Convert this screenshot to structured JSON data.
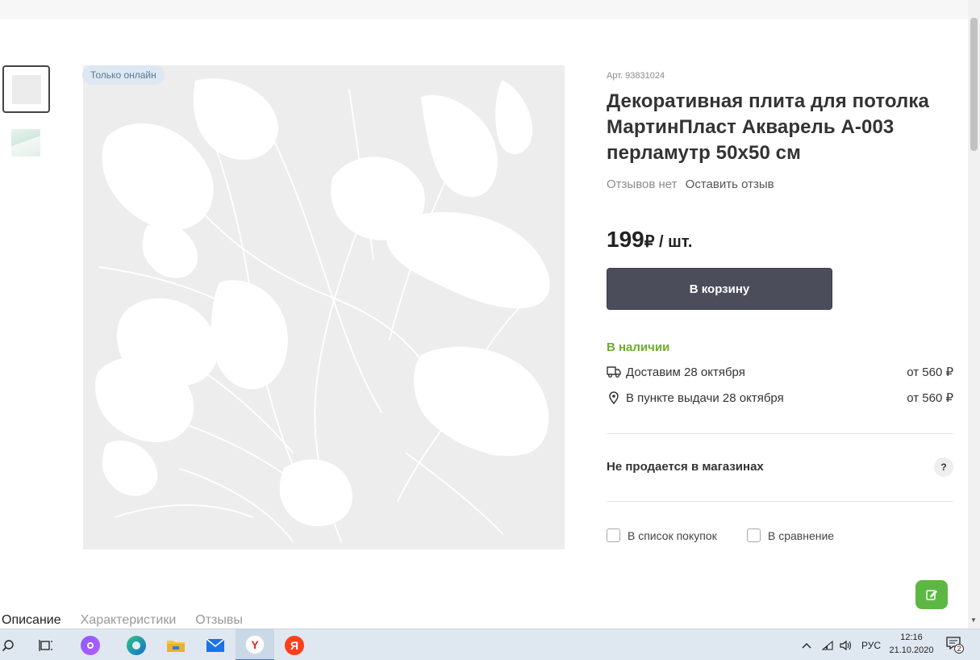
{
  "product": {
    "badge": "Только онлайн",
    "article": "Арт. 93831024",
    "title": "Декоративная плита для потолка МартинПласт Акварель А-003 перламутр 50x50 см",
    "reviews_none": "Отзывов нет",
    "leave_review": "Оставить отзыв",
    "price": "199",
    "price_unit": "₽ / шт.",
    "cart_button": "В корзину",
    "stock": "В наличии",
    "delivery": {
      "label": "Доставим 28 октября",
      "price": "от 560 ₽"
    },
    "pickup": {
      "label": "В пункте выдачи 28 октября",
      "price": "от 560 ₽"
    },
    "not_sold": "Не продается в магазинах",
    "help": "?",
    "shopping_list": "В список покупок",
    "compare": "В сравнение"
  },
  "tabs": [
    {
      "label": "Описание",
      "active": true
    },
    {
      "label": "Характеристики",
      "active": false
    },
    {
      "label": "Отзывы",
      "active": false
    }
  ],
  "taskbar": {
    "lang": "РУС",
    "time": "12:16",
    "date": "21.10.2020",
    "notifications": "2",
    "apps": [
      "search-icon",
      "task-view-icon",
      "alice-icon",
      "edge-icon",
      "file-explorer-icon",
      "mail-icon",
      "yandex-browser-icon",
      "yandex-icon"
    ]
  },
  "colors": {
    "accent_green": "#6bae2c",
    "button_dark": "#4b4d5a",
    "float_green": "#5cb843"
  }
}
